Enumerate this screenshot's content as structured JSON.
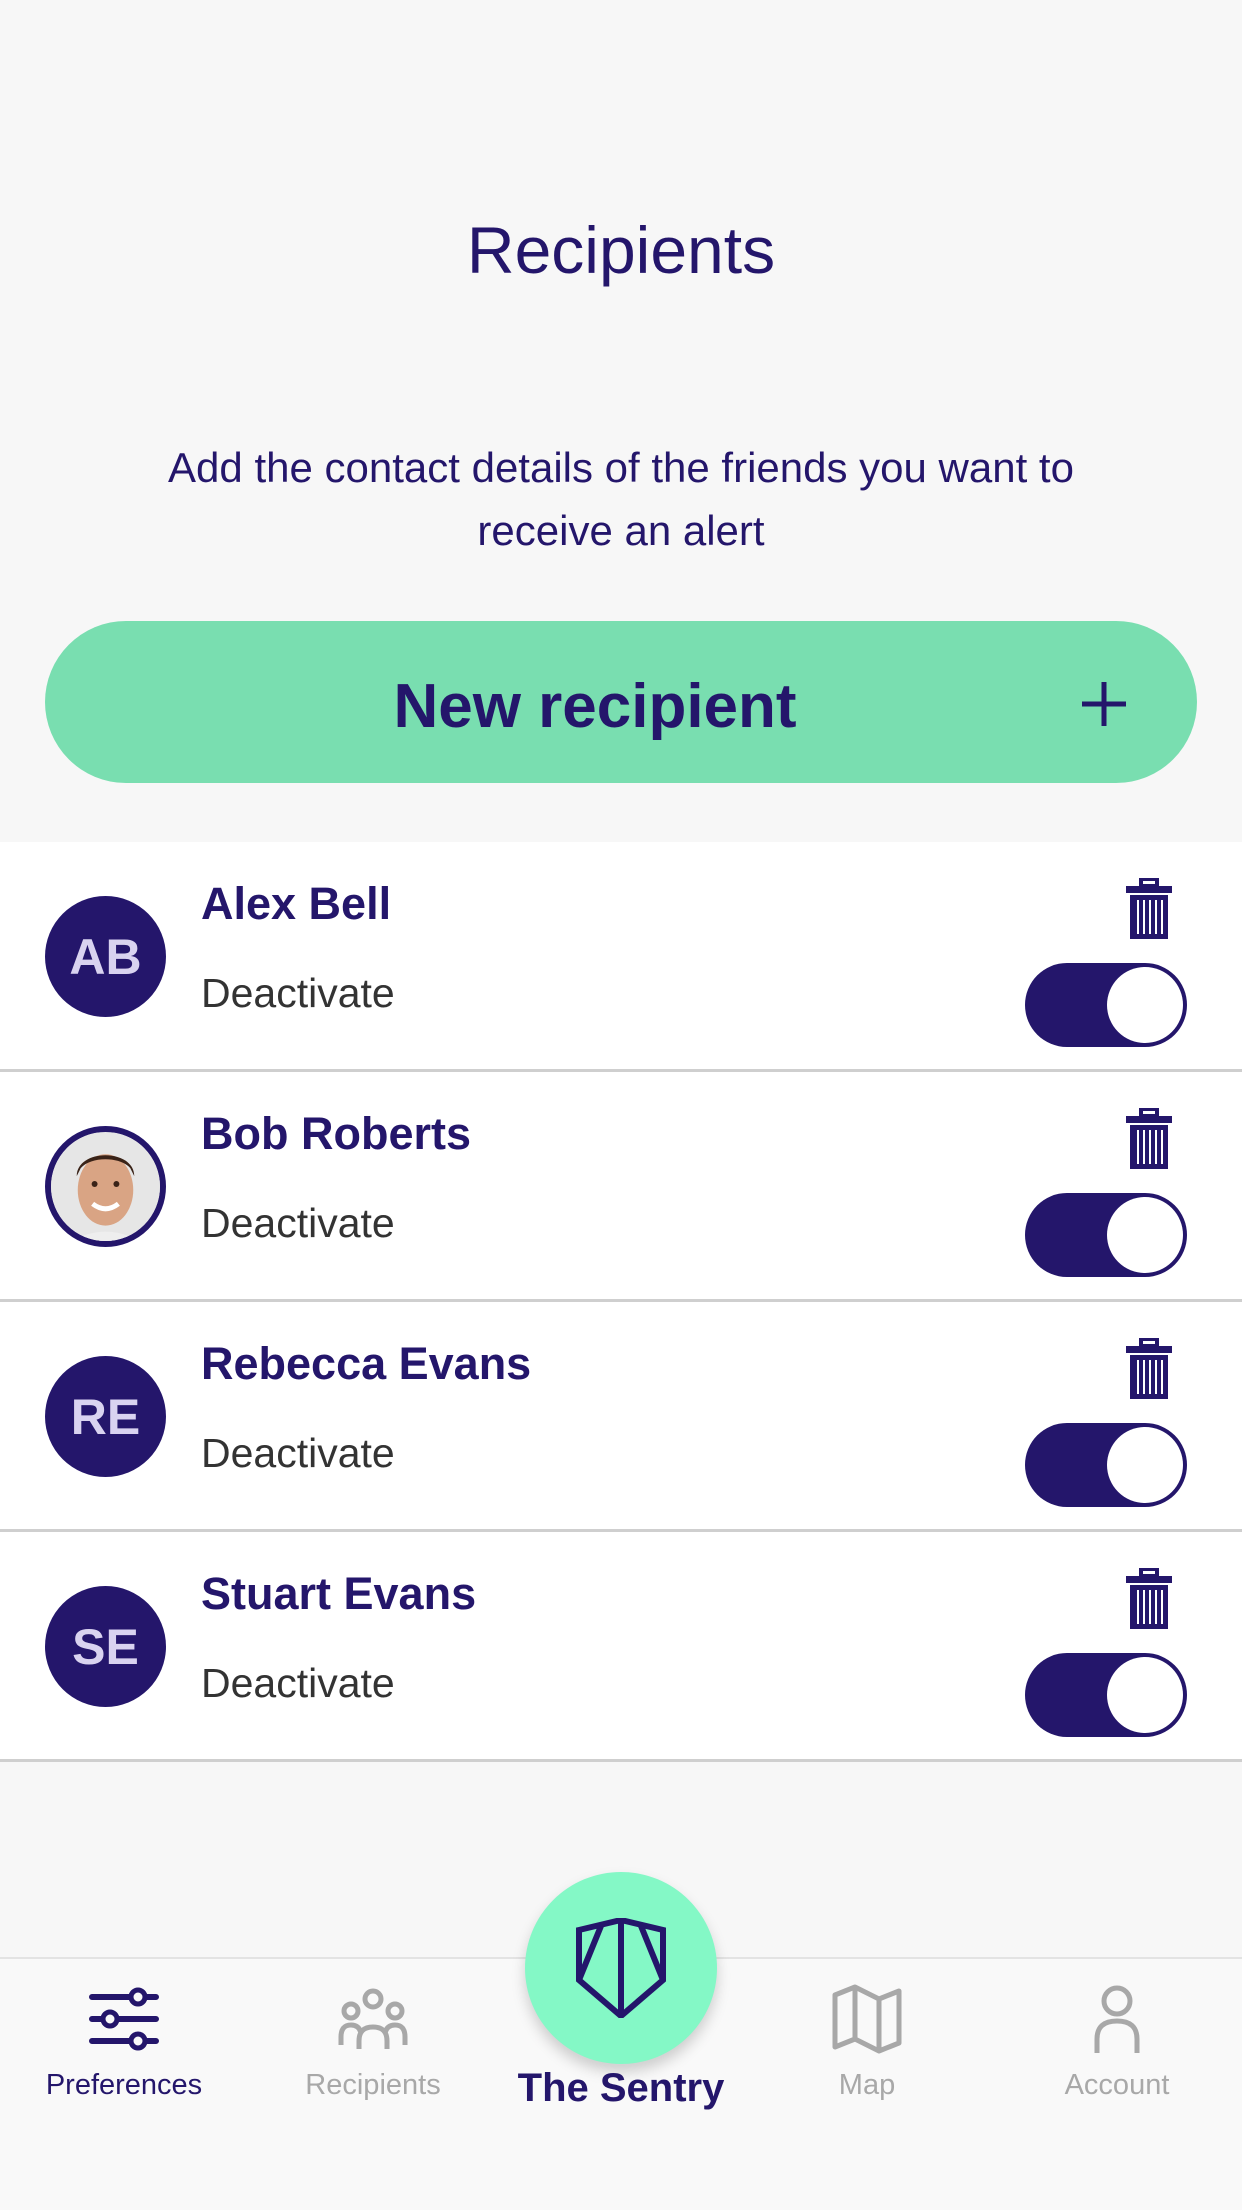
{
  "header": {
    "title": "Recipients",
    "subtitle_line1": "Add the contact details of the friends you want to",
    "subtitle_line2": "receive an alert"
  },
  "new_recipient": {
    "label": "New recipient",
    "icon": "plus-icon"
  },
  "recipients": [
    {
      "name": "Alex Bell",
      "initials": "AB",
      "has_photo": false,
      "toggle_label": "Deactivate",
      "active": true
    },
    {
      "name": "Bob Roberts",
      "initials": "",
      "has_photo": true,
      "toggle_label": "Deactivate",
      "active": true
    },
    {
      "name": "Rebecca Evans",
      "initials": "RE",
      "has_photo": false,
      "toggle_label": "Deactivate",
      "active": true
    },
    {
      "name": "Stuart Evans",
      "initials": "SE",
      "has_photo": false,
      "toggle_label": "Deactivate",
      "active": true
    }
  ],
  "nav": {
    "items": [
      {
        "label": "Preferences",
        "icon": "sliders-icon",
        "active": true
      },
      {
        "label": "Recipients",
        "icon": "people-icon",
        "active": false
      },
      {
        "label": "The Sentry",
        "icon": "shield-icon",
        "active": false
      },
      {
        "label": "Map",
        "icon": "map-icon",
        "active": false
      },
      {
        "label": "Account",
        "icon": "user-icon",
        "active": false
      }
    ]
  },
  "colors": {
    "primary": "#24166b",
    "accent": "#79deb0",
    "sentry": "#84f8c6",
    "inactive": "#a8a8a8"
  }
}
